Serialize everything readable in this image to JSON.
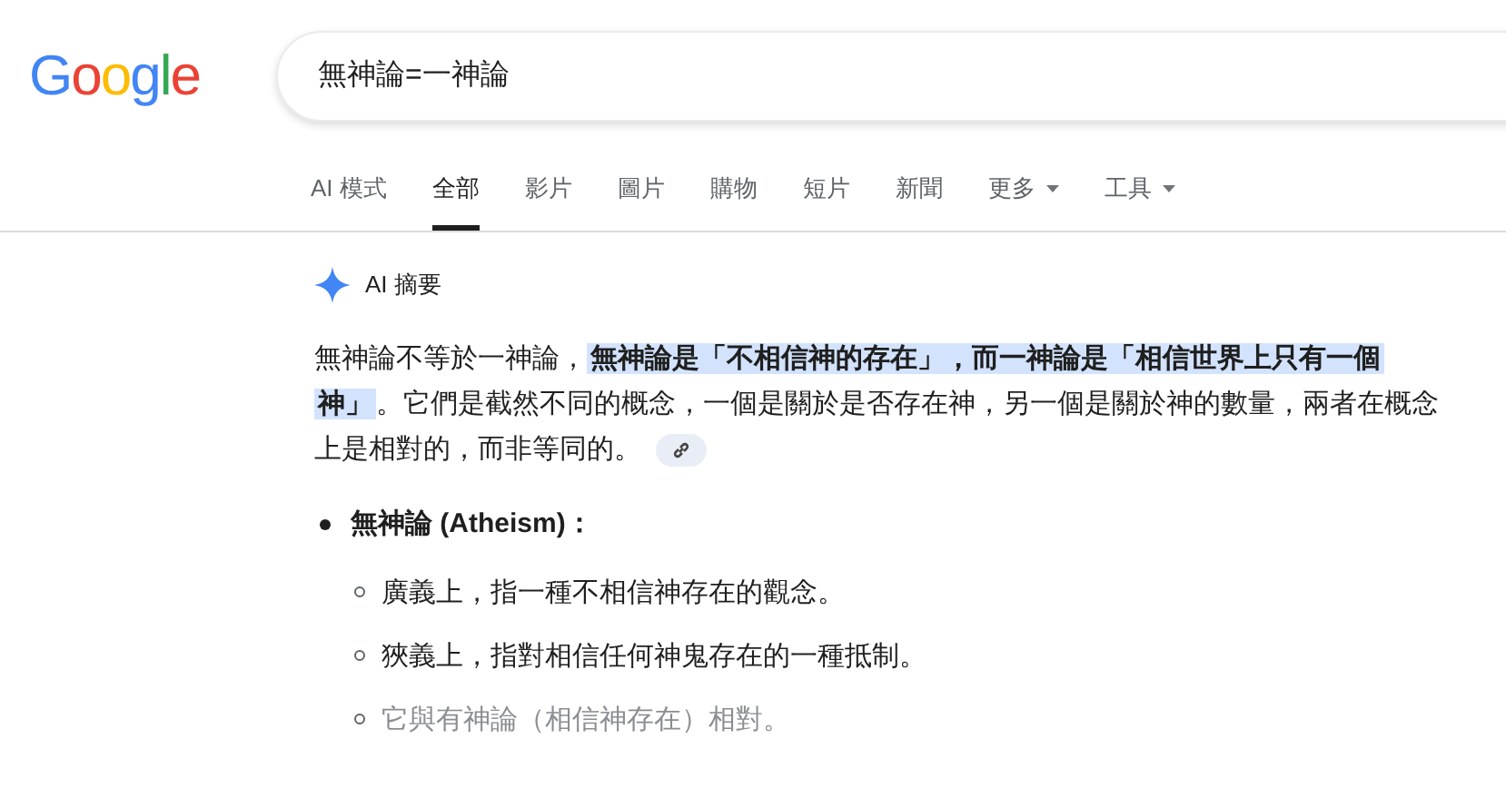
{
  "logo": "Google",
  "search": {
    "value": "無神論=一神論"
  },
  "tabs": [
    {
      "label": "AI 模式",
      "selected": false,
      "dropdown": false
    },
    {
      "label": "全部",
      "selected": true,
      "dropdown": false
    },
    {
      "label": "影片",
      "selected": false,
      "dropdown": false
    },
    {
      "label": "圖片",
      "selected": false,
      "dropdown": false
    },
    {
      "label": "購物",
      "selected": false,
      "dropdown": false
    },
    {
      "label": "短片",
      "selected": false,
      "dropdown": false
    },
    {
      "label": "新聞",
      "selected": false,
      "dropdown": false
    },
    {
      "label": "更多",
      "selected": false,
      "dropdown": true
    },
    {
      "label": "工具",
      "selected": false,
      "dropdown": true
    }
  ],
  "ai_overview": {
    "title": "AI 摘要",
    "paragraph": [
      {
        "text": "無神論不等於一神論，",
        "highlighted": false
      },
      {
        "text": "無神論是「不相信神的存在」，而一神論是「相信世界上只有一個神」",
        "highlighted": true
      },
      {
        "text": "。它們是截然不同的概念，一個是關於是否存在神，另一個是關於神的數量，兩者在概念上是相對的，而非等同的。",
        "highlighted": false
      }
    ],
    "list": [
      {
        "title": "無神論 (Atheism)：",
        "children": [
          {
            "text": "廣義上，指一種不相信神存在的觀念。",
            "faded": false
          },
          {
            "text": "狹義上，指對相信任何神鬼存在的一種抵制。",
            "faded": false
          },
          {
            "text": "它與有神論（相信神存在）相對。",
            "faded": true
          }
        ]
      }
    ]
  }
}
